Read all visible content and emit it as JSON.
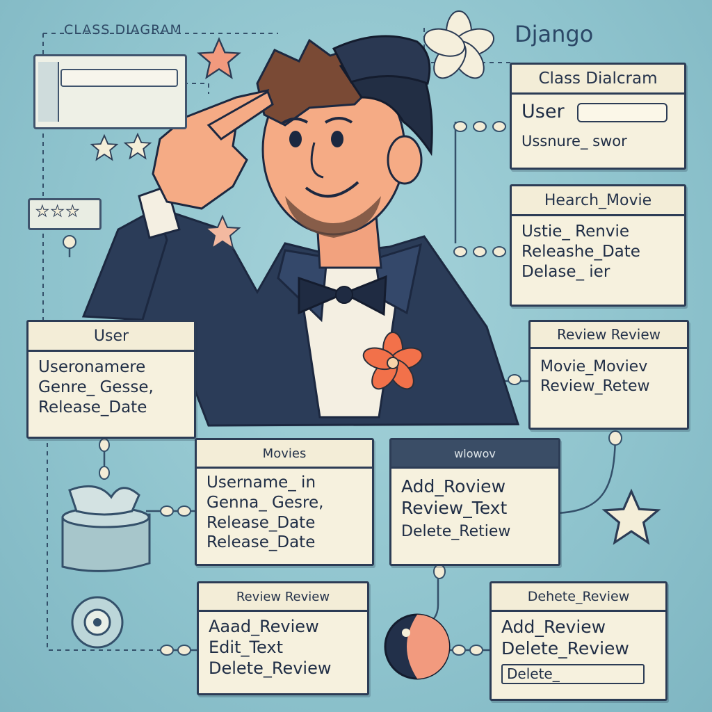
{
  "diagram": {
    "caption": "CLASS DIAGRAM",
    "brand": "Django",
    "classes": [
      {
        "id": "class-diagram",
        "title": "Class Dialcram",
        "rows": [
          "User",
          "Ussnure_ swor"
        ]
      },
      {
        "id": "search-movie",
        "title": "Hearch_Movie",
        "rows": [
          "Ustie_ Renvie",
          "Releashe_Date",
          "Delase_ ier"
        ]
      },
      {
        "id": "user",
        "title": "User",
        "rows": [
          "Useronamere",
          "Genre_ Gesse,",
          "Release_Date"
        ]
      },
      {
        "id": "review-top",
        "title": "Review Review",
        "rows": [
          "Movie_Moviev",
          "Review_Retew"
        ]
      },
      {
        "id": "movies",
        "title": "Movies",
        "rows": [
          "Username_ in",
          "Genna_ Gesre,",
          "Release_Date",
          "Release_Date"
        ]
      },
      {
        "id": "mlowov",
        "title": "wlowov",
        "rows": [
          "Add_Roview",
          "Review_Text",
          "Delete_Retiew"
        ]
      },
      {
        "id": "review-bottom",
        "title": "Review Review",
        "rows": [
          "Aaad_Review",
          "Edit_Text",
          "Delete_Review"
        ]
      },
      {
        "id": "delete-review",
        "title": "Dehete_Review",
        "rows": [
          "Add_Review",
          "Delete_Review",
          "Delete_"
        ]
      }
    ]
  },
  "colors": {
    "background": "#8fc3cf",
    "box_fill": "#f6f1de",
    "box_border": "#2c3c55",
    "star": "#f29a7e",
    "suit": "#2b3c58"
  }
}
